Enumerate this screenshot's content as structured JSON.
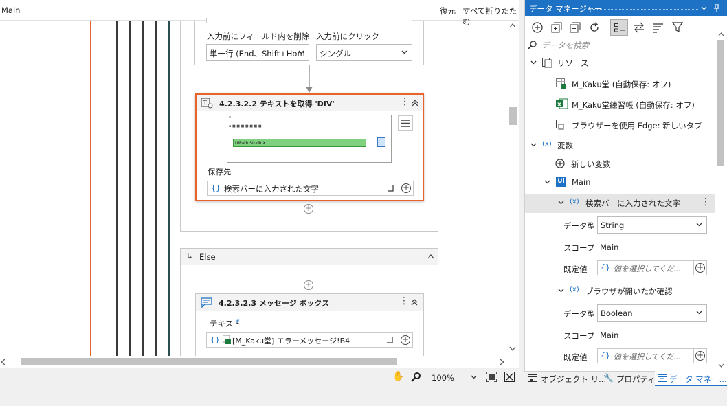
{
  "designer": {
    "tab_title": "Main",
    "restore": "復元",
    "collapse_all": "すべて折りたたむ",
    "field_clear_label": "入力前にフィールド内を削除",
    "field_clear_value": "単一行 (End、Shift+Hom",
    "click_before_label": "入力前にクリック",
    "click_before_value": "シングル",
    "activity1": {
      "title": "4.2.3.2.2 テキストを取得 'DIV'",
      "screenshot_text": "UiPath StudioX",
      "output_label": "保存先",
      "output_value": "検索バーに入力された文字"
    },
    "else_label": "Else",
    "activity2": {
      "title": "4.2.3.2.3 メッセージ ボックス",
      "text_label": "テキスト",
      "required_mark": "*",
      "text_value": "[M_Kaku堂] エラーメッセージ!B4"
    },
    "zoom": "100%"
  },
  "data_manager": {
    "title": "データ マネージャー",
    "search_placeholder": "データを検索",
    "resources_label": "リソース",
    "resources": [
      "M_Kaku堂 (自動保存: オフ)",
      "M_Kaku堂練習帳 (自動保存: オフ)",
      "ブラウザーを使用 Edge: 新しいタブ"
    ],
    "variables_label": "変数",
    "new_variable": "新しい変数",
    "main_label": "Main",
    "var1": {
      "name": "検索バーに入力された文字",
      "type_label": "データ型",
      "type_value": "String",
      "scope_label": "スコープ",
      "scope_value": "Main",
      "default_label": "既定値",
      "default_placeholder": "値を選択してくだ..."
    },
    "var2": {
      "name": "ブラウザが開いたか確認",
      "type_label": "データ型",
      "type_value": "Boolean",
      "scope_label": "スコープ",
      "scope_value": "Main",
      "default_label": "既定値",
      "default_placeholder": "値を選択してくだ..."
    }
  },
  "bottom_tabs": [
    "オブジェクト リ...",
    "プロパティ",
    "データ マネー..."
  ],
  "colors": {
    "accent": "#1e72c5",
    "selected_border": "#e8632b",
    "excel_green": "#1d7a3f",
    "timeline": "#e8632b"
  }
}
